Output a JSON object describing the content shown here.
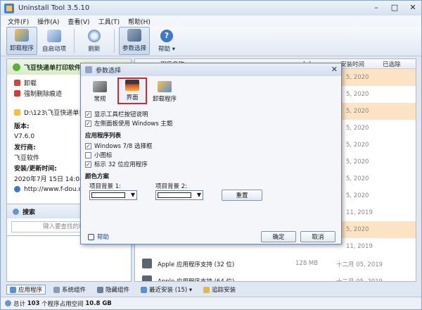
{
  "window": {
    "title": "Uninstall Tool 3.5.10"
  },
  "menu": [
    "文件(F)",
    "操作(A)",
    "查看(V)",
    "工具(T)",
    "帮助(H)"
  ],
  "toolbar": {
    "uninstall": "卸载程序",
    "startup": "自启动项",
    "refresh": "刷新",
    "options": "参数选择",
    "help": "帮助 ▾"
  },
  "left_panel": {
    "app_name": "飞豆快递单打印软件",
    "uninstall": "卸载",
    "force_remove": "强制删除痕迹",
    "path": "D:\\123\\飞豆快递单打",
    "version_label": "版本:",
    "version": "V7.6.0",
    "publisher_label": "发行商:",
    "publisher": "飞豆软件",
    "install_date_label": "安装/更新时间:",
    "install_date": "2020年7月 15日 14:08:34",
    "url": "http://www.f-dou.com",
    "search_label": "搜索",
    "search_placeholder": "键入要查找的程"
  },
  "list": {
    "columns": [
      "程序名称",
      "大小",
      "安装时间",
      "已选除"
    ],
    "rows": [
      {
        "date": "5, 2020",
        "hl": true
      },
      {
        "date": "5, 2020",
        "hl": false
      },
      {
        "date": "5, 2020",
        "hl": true
      },
      {
        "date": "5, 2020",
        "hl": false
      },
      {
        "date": "5, 2020",
        "hl": false
      },
      {
        "date": "5, 2020",
        "hl": false
      },
      {
        "date": "5, 2020",
        "hl": false
      },
      {
        "date": "5, 2020",
        "hl": false
      },
      {
        "date": "11, 2019",
        "hl": false
      },
      {
        "date": "5, 2020",
        "hl": true
      },
      {
        "date": "11, 2019",
        "hl": false
      }
    ],
    "bottom_rows": [
      {
        "name": "Apple 应用程序支持 (32 位)",
        "size": "128 MB",
        "date": "十二月 05, 2019"
      },
      {
        "name": "Apple 应用程序支持 (64 位)",
        "size": "",
        "date": "十二月 05, 2019"
      }
    ]
  },
  "tabs": [
    "应用程序",
    "系统组件",
    "隐藏组件",
    "最近安装 (15) ▾",
    "追踪安装"
  ],
  "status": {
    "prefix": "总计",
    "count": "103",
    "middle": "个程序占用空间",
    "size": "10.8 GB"
  },
  "dialog": {
    "title": "参数选择",
    "tabs": [
      "常规",
      "界面",
      "卸载程序"
    ],
    "opt_toolbar_desc": "显示工具栏按钮说明",
    "opt_left_panel": "左侧面板使用 Windows 主题",
    "section_list": "应用程序列表",
    "opt_win78": "Windows 7/8 选择框",
    "opt_small_icons": "小图标",
    "opt_mark32": "标示 32 位应用程序",
    "section_colors": "颜色方案",
    "bg1_label": "项目背景 1:",
    "bg2_label": "项目背景 2:",
    "reset": "重置",
    "help": "帮助",
    "ok": "确定",
    "cancel": "取消"
  },
  "colors": {
    "accent": "#d8262e",
    "row_highlight": "#fbe3c3",
    "title_bar": "#d5e1f0"
  }
}
